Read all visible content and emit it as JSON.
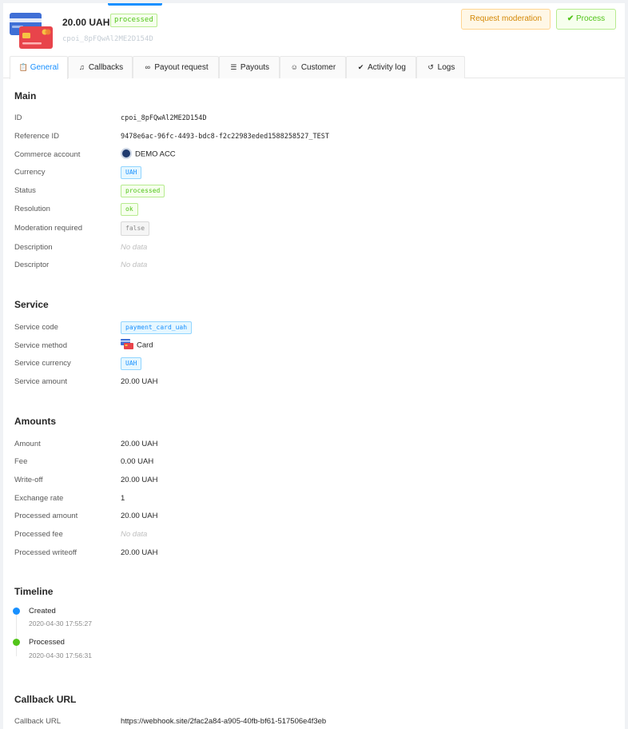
{
  "header": {
    "amount": "20.00 UAH",
    "status_badge": "processed",
    "payment_id": "cpoi_8pFQwAl2ME2D154D",
    "buttons": {
      "request_moderation": "Request moderation",
      "process": "Process"
    }
  },
  "tabs": [
    {
      "label": "General",
      "icon": "clipboard-icon",
      "active": true
    },
    {
      "label": "Callbacks",
      "icon": "bell-icon"
    },
    {
      "label": "Payout request",
      "icon": "link-icon"
    },
    {
      "label": "Payouts",
      "icon": "list-icon"
    },
    {
      "label": "Customer",
      "icon": "user-icon"
    },
    {
      "label": "Activity log",
      "icon": "double-check-icon"
    },
    {
      "label": "Logs",
      "icon": "history-icon"
    }
  ],
  "main": {
    "title": "Main",
    "id_label": "ID",
    "id_value": "cpoi_8pFQwAl2ME2D154D",
    "reference_label": "Reference ID",
    "reference_value": "9478e6ac-96fc-4493-bdc8-f2c22983eded1588258527_TEST",
    "commerce_label": "Commerce account",
    "commerce_value": "DEMO ACC",
    "currency_label": "Currency",
    "currency_value": "UAH",
    "status_label": "Status",
    "status_value": "processed",
    "resolution_label": "Resolution",
    "resolution_value": "ok",
    "moderation_label": "Moderation required",
    "moderation_value": "false",
    "description_label": "Description",
    "description_value": "No data",
    "descriptor_label": "Descriptor",
    "descriptor_value": "No data"
  },
  "service": {
    "title": "Service",
    "code_label": "Service code",
    "code_value": "payment_card_uah",
    "method_label": "Service method",
    "method_value": "Card",
    "currency_label": "Service currency",
    "currency_value": "UAH",
    "amount_label": "Service amount",
    "amount_value": "20.00 UAH"
  },
  "amounts": {
    "title": "Amounts",
    "amount_label": "Amount",
    "amount_value": "20.00 UAH",
    "fee_label": "Fee",
    "fee_value": "0.00 UAH",
    "writeoff_label": "Write-off",
    "writeoff_value": "20.00 UAH",
    "rate_label": "Exchange rate",
    "rate_value": "1",
    "processed_amount_label": "Processed amount",
    "processed_amount_value": "20.00 UAH",
    "processed_fee_label": "Processed fee",
    "processed_fee_value": "No data",
    "processed_writeoff_label": "Processed writeoff",
    "processed_writeoff_value": "20.00 UAH"
  },
  "timeline": {
    "title": "Timeline",
    "events": [
      {
        "title": "Created",
        "time": "2020-04-30 17:55:27",
        "color": "#1890ff"
      },
      {
        "title": "Processed",
        "time": "2020-04-30 17:56:31",
        "color": "#52c41a"
      }
    ]
  },
  "callback": {
    "title": "Callback URL",
    "url_label": "Callback URL",
    "url_value": "https://webhook.site/2fac2a84-a905-40fb-bf61-517506e4f3eb"
  },
  "colors": {
    "accent": "#1890ff",
    "success": "#52c41a",
    "warning": "#d48806"
  }
}
